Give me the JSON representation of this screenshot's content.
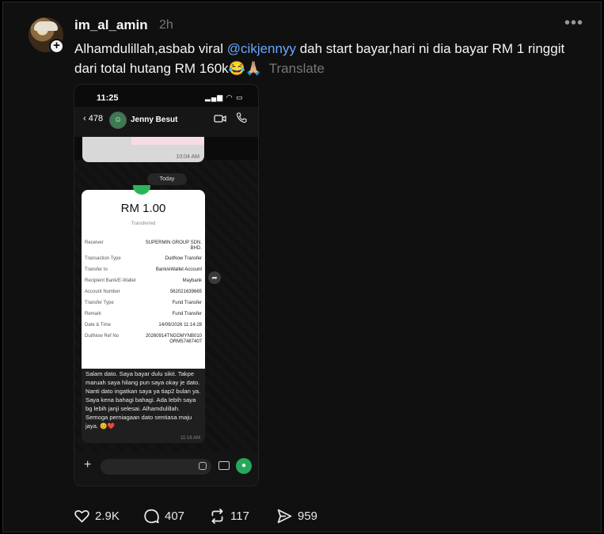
{
  "post": {
    "username": "im_al_amin",
    "time_ago": "2h",
    "text_before": "Alhamdulillah,asbab viral ",
    "mention": "@cikjennyy",
    "text_after": " dah start bayar,hari ni dia bayar RM 1 ringgit dari total hutang RM 160k😂🙏🏼",
    "translate_label": "Translate",
    "more_label": "•••",
    "follow_label": "+"
  },
  "screenshot": {
    "status_time": "11:25",
    "chat": {
      "back_count": "478",
      "contact_name": "Jenny Besut"
    },
    "prev_message_time": "10:04 AM",
    "date_pill": "Today",
    "receipt": {
      "amount": "RM  1.00",
      "status": "Transferred",
      "rows": [
        {
          "label": "Receiver",
          "value": "SUPERMIN GROUP SDN. BHD."
        },
        {
          "label": "Transaction Type",
          "value": "DuitNow Transfer"
        },
        {
          "label": "Transfer to",
          "value": "Bank/eWallet Account"
        },
        {
          "label": "Recipient Bank/E-Wallet",
          "value": "Maybank"
        },
        {
          "label": "Account Number",
          "value": "562021639665"
        },
        {
          "label": "Transfer Type",
          "value": "Fund Transfer"
        },
        {
          "label": "Remark",
          "value": "Fund Transfer"
        },
        {
          "label": "Date & Time",
          "value": "14/09/2026 11:14:28"
        },
        {
          "label": "DuitNow Ref No",
          "value": "20260914TNGDMYNB010ORM57487407"
        }
      ]
    },
    "message": {
      "text": "Salam dato. Saya bayar dulu sikit. Takpe maruah saya hilang pun saya okay je dato. Nanti dato ingatkan saya ya tiap2 bulan ya. Saya kena bahagi bahagi. Ada lebih saya bg lebih janji selesai. Alhamdulillah. Semoga perniagaan dato sentiasa maju jaya. 😊❤️",
      "time": "11:16 AM"
    }
  },
  "actions": {
    "likes": "2.9K",
    "comments": "407",
    "reposts": "117",
    "shares": "959"
  },
  "colors": {
    "mention": "#6aa6ff",
    "background": "#101010",
    "whatsapp_green": "#25a85a"
  }
}
